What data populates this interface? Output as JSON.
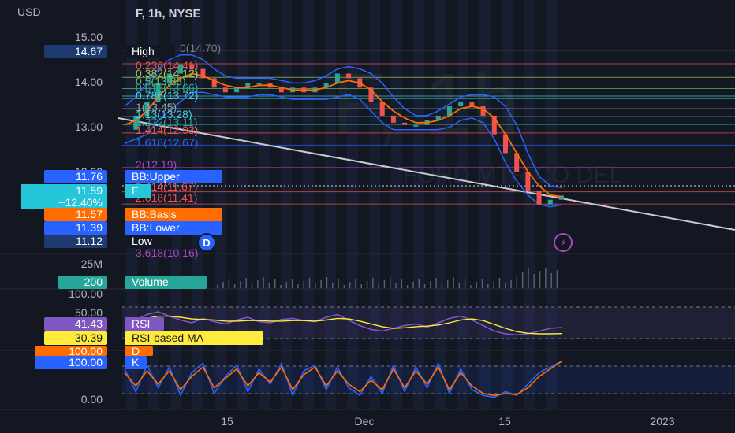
{
  "header": {
    "currency": "USD",
    "symbol_line": "F, 1h, NYSE"
  },
  "watermark": {
    "big": "F, 1h",
    "company": "FORD MTR CO DEL"
  },
  "colors": {
    "background": "#131722",
    "candle_up": "#26a69a",
    "candle_down": "#ef5350",
    "bb_band": "#2962ff",
    "bb_basis": "#ff6d00",
    "rsi": "#7e57c2",
    "rsi_ma": "#ffeb3b",
    "stoch_k": "#2962ff",
    "stoch_d": "#ff6d00",
    "volume": "#5a5f6e"
  },
  "price_axis": {
    "ticks": [
      "15.00",
      "14.00",
      "13.00",
      "12.00"
    ]
  },
  "volume_axis": {
    "ticks": [
      "25M"
    ]
  },
  "rsi_axis": {
    "ticks": [
      "100.00",
      "50.00"
    ]
  },
  "stoch_axis": {
    "ticks": [
      "100.00",
      "0.00"
    ]
  },
  "time_axis": {
    "ticks": [
      "15",
      "Dec",
      "15",
      "2023"
    ]
  },
  "fib_levels": [
    {
      "label": "0.236(14.41)",
      "value": 14.41,
      "color": "#ef5350"
    },
    {
      "label": "0.382(14.12)",
      "value": 14.12,
      "color": "#9ccc65"
    },
    {
      "label": "0.5(13.88)",
      "value": 13.88,
      "color": "#66bb6a"
    },
    {
      "label": "0.618(13.66)",
      "value": 13.66,
      "color": "#26a69a"
    },
    {
      "label": "0.786(13.72)",
      "value": 13.72,
      "color": "#4dd0e1"
    },
    {
      "label": "1(13.45)",
      "value": 13.45,
      "color": "#90a4ae"
    },
    {
      "label": "1.13(13.28)",
      "value": 13.28,
      "color": "#4dd0e1"
    },
    {
      "label": "1.272(13.11)",
      "value": 13.11,
      "color": "#26a69a"
    },
    {
      "label": "1.414(12.93)",
      "value": 12.93,
      "color": "#ef5350"
    },
    {
      "label": "1.618(12.67)",
      "value": 12.67,
      "color": "#2962ff"
    },
    {
      "label": "2(12.19)",
      "value": 12.19,
      "color": "#ab47bc"
    },
    {
      "label": "2.414(11.67)",
      "value": 11.67,
      "color": "#ef5350"
    },
    {
      "label": "2.618(11.41)",
      "value": 11.41,
      "color": "#ef5350"
    },
    {
      "label": "3.618(10.16)",
      "value": 10.16,
      "color": "#ab47bc"
    },
    {
      "label": "0(14.70)",
      "value": 14.7,
      "color": "#787b86"
    }
  ],
  "badges": {
    "high": {
      "value": "14.67",
      "label": "High",
      "color": "#1e3a6e"
    },
    "bb_upper": {
      "value": "11.76",
      "label": "BB:Upper",
      "color": "#2962ff"
    },
    "price": {
      "value": "11.59",
      "change": "−12.40%",
      "label": "F",
      "color": "#26c6da"
    },
    "bb_basis": {
      "value": "11.57",
      "label": "BB:Basis",
      "color": "#ff6d00"
    },
    "bb_lower": {
      "value": "11.39",
      "label": "BB:Lower",
      "color": "#2962ff"
    },
    "low": {
      "value": "11.12",
      "label": "Low",
      "color": "#1e3a6e"
    },
    "volume": {
      "value": "200",
      "label": "Volume",
      "color": "#26a69a"
    },
    "rsi": {
      "value": "41.43",
      "label": "RSI",
      "color": "#7e57c2"
    },
    "rsi_ma": {
      "value": "30.39",
      "label": "RSI-based MA",
      "color": "#ffeb3b"
    },
    "stoch_d": {
      "value": "100.00",
      "label": "D",
      "color": "#ff6d00"
    },
    "stoch_k": {
      "value": "100.00",
      "label": "K",
      "color": "#2962ff"
    }
  },
  "markers": {
    "dividend": "D",
    "flash": "⚡"
  },
  "chart_data": {
    "type": "line",
    "title": "F, 1h, NYSE",
    "ylabel": "USD",
    "ylim": [
      10.3,
      15.0
    ],
    "x_ticks": [
      "15",
      "Dec",
      "15",
      "2023"
    ],
    "series": [
      {
        "name": "F",
        "values": [
          13.0,
          13.3,
          13.6,
          14.0,
          14.2,
          14.4,
          14.3,
          14.1,
          13.9,
          13.8,
          13.9,
          14.0,
          14.0,
          13.9,
          13.8,
          13.9,
          13.8,
          13.9,
          14.0,
          14.2,
          14.1,
          13.9,
          13.6,
          13.3,
          13.15,
          13.1,
          13.1,
          13.2,
          13.3,
          13.5,
          13.6,
          13.5,
          13.3,
          12.9,
          12.5,
          12.1,
          11.7,
          11.4,
          11.5,
          11.59
        ]
      },
      {
        "name": "BB:Basis",
        "values": [
          13.1,
          13.2,
          13.4,
          13.7,
          13.95,
          14.1,
          14.2,
          14.15,
          14.05,
          13.95,
          13.9,
          13.9,
          13.95,
          13.95,
          13.9,
          13.85,
          13.85,
          13.85,
          13.9,
          14.0,
          14.05,
          14.0,
          13.85,
          13.6,
          13.4,
          13.25,
          13.15,
          13.15,
          13.2,
          13.3,
          13.45,
          13.5,
          13.45,
          13.25,
          12.9,
          12.5,
          12.1,
          11.8,
          11.6,
          11.57
        ]
      },
      {
        "name": "BB:Upper",
        "values": [
          13.5,
          13.7,
          14.0,
          14.3,
          14.5,
          14.6,
          14.6,
          14.5,
          14.3,
          14.15,
          14.1,
          14.1,
          14.1,
          14.1,
          14.05,
          14.0,
          14.0,
          14.05,
          14.15,
          14.3,
          14.35,
          14.3,
          14.2,
          14.0,
          13.7,
          13.45,
          13.3,
          13.3,
          13.4,
          13.55,
          13.7,
          13.75,
          13.75,
          13.7,
          13.5,
          13.1,
          12.5,
          12.0,
          11.8,
          11.76
        ]
      },
      {
        "name": "BB:Lower",
        "values": [
          12.7,
          12.8,
          12.9,
          13.2,
          13.4,
          13.6,
          13.8,
          13.8,
          13.75,
          13.7,
          13.7,
          13.7,
          13.75,
          13.75,
          13.7,
          13.65,
          13.65,
          13.65,
          13.65,
          13.7,
          13.75,
          13.65,
          13.4,
          13.15,
          13.0,
          13.0,
          13.0,
          13.0,
          13.0,
          13.05,
          13.2,
          13.25,
          13.15,
          12.8,
          12.3,
          11.9,
          11.6,
          11.4,
          11.35,
          11.39
        ]
      },
      {
        "name": "RSI",
        "values": [
          45,
          55,
          65,
          70,
          62,
          55,
          50,
          58,
          52,
          48,
          55,
          60,
          52,
          50,
          56,
          58,
          54,
          52,
          60,
          65,
          55,
          45,
          38,
          35,
          40,
          45,
          48,
          42,
          50,
          58,
          62,
          55,
          45,
          35,
          30,
          28,
          30,
          35,
          40,
          41.43
        ]
      },
      {
        "name": "RSI-based MA",
        "values": [
          48,
          52,
          58,
          62,
          62,
          60,
          57,
          56,
          55,
          53,
          53,
          54,
          54,
          53,
          53,
          54,
          54,
          53,
          55,
          58,
          57,
          53,
          48,
          43,
          40,
          41,
          43,
          44,
          46,
          50,
          55,
          57,
          54,
          47,
          40,
          34,
          31,
          30,
          30,
          30.39
        ]
      },
      {
        "name": "K",
        "values": [
          80,
          20,
          90,
          30,
          85,
          10,
          70,
          95,
          15,
          60,
          90,
          20,
          80,
          40,
          95,
          10,
          75,
          90,
          25,
          85,
          30,
          10,
          60,
          15,
          90,
          20,
          85,
          30,
          95,
          15,
          80,
          25,
          10,
          5,
          20,
          10,
          40,
          70,
          85,
          100
        ]
      },
      {
        "name": "D",
        "values": [
          70,
          35,
          75,
          40,
          75,
          25,
          60,
          85,
          30,
          55,
          80,
          35,
          70,
          45,
          85,
          25,
          65,
          85,
          35,
          75,
          40,
          20,
          50,
          25,
          80,
          30,
          75,
          40,
          85,
          25,
          70,
          35,
          15,
          10,
          15,
          12,
          30,
          60,
          80,
          100
        ]
      }
    ]
  }
}
